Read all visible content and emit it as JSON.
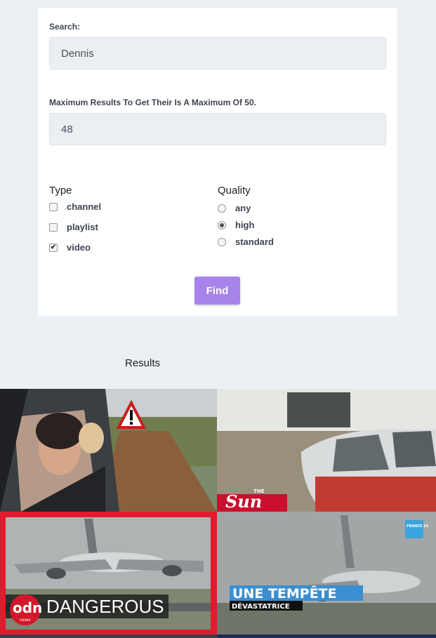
{
  "search": {
    "label": "Search:",
    "value": "Dennis"
  },
  "max_results": {
    "label": "Maximum Results To Get Their Is A Maximum Of 50.",
    "value": "48"
  },
  "type_group": {
    "title": "Type",
    "options": [
      {
        "label": "channel",
        "checked": false
      },
      {
        "label": "playlist",
        "checked": false
      },
      {
        "label": "video",
        "checked": true
      }
    ]
  },
  "quality_group": {
    "title": "Quality",
    "options": [
      {
        "label": "any",
        "selected": false
      },
      {
        "label": "high",
        "selected": true
      },
      {
        "label": "standard",
        "selected": false
      }
    ]
  },
  "find_button": {
    "label": "Find",
    "color": "#a783ea"
  },
  "results": {
    "heading": "Results",
    "thumbnails": [
      {
        "caption": ""
      },
      {
        "caption": "Sun",
        "logo_text": "THE"
      },
      {
        "caption": "DANGEROUS",
        "logo_text": "odn",
        "logo_sub": "news"
      },
      {
        "caption": "UNE TEMPÊTE",
        "subcaption": "DÉVASTATRICE",
        "logo_text": "FRANCE 24"
      }
    ]
  }
}
